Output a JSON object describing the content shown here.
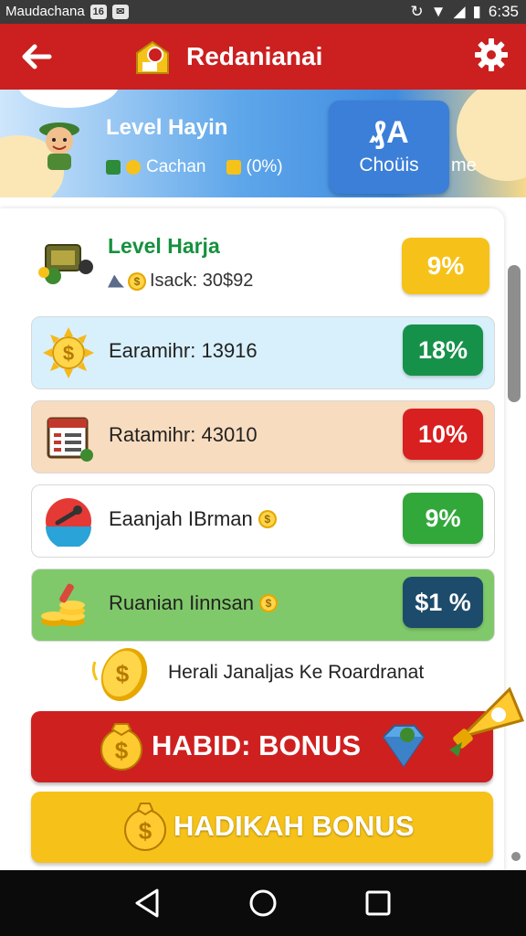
{
  "status_bar": {
    "carrier": "Maudachana",
    "time": "6:35"
  },
  "app_bar": {
    "title": "Redanianai"
  },
  "banner": {
    "level_title": "Level Hayin",
    "level_sub": "Cachan",
    "level_pct": "(0%)",
    "choose_glyph": "₰A",
    "choose_label": "Choüis",
    "trailing_text": "me"
  },
  "level_card": {
    "title": "Level Harja",
    "subtitle": "Isack: 30$92",
    "percent": "9%"
  },
  "rows": [
    {
      "label": "Earamihr: 13916",
      "percent": "18%",
      "bg": "#d8f0fb",
      "pill": "#16914a"
    },
    {
      "label": "Ratamihr: 43010",
      "percent": "10%",
      "bg": "#f8dcbf",
      "pill": "#d82020"
    },
    {
      "label": "Eaanjah IBrman",
      "percent": "9%",
      "bg": "#ffffff",
      "pill": "#32a83a"
    },
    {
      "label": "Ruanian Iinnsan",
      "percent": "$1 %",
      "bg": "#80c96a",
      "pill": "#1d4b6b"
    }
  ],
  "hint_text": "Herali Janaljas Ke Roardranat",
  "bonus_primary": "HABID: BONUS",
  "bonus_secondary": "HADIKAH BONUS",
  "colors": {
    "app_bar": "#cc1f1f",
    "level_pill": "#f6c21a",
    "bonus_primary": "#cf2020",
    "bonus_secondary": "#f6c21a",
    "accent_green": "#16913e"
  },
  "icons": [
    "back-arrow-icon",
    "app-logo-icon",
    "gear-icon",
    "avatar",
    "cannon-icon",
    "sun-coin-icon",
    "calendar-icon",
    "bowling-icon",
    "coin-stack-icon",
    "coin-icon",
    "gem-icon",
    "megaphone-icon",
    "nav-back-icon",
    "nav-home-icon",
    "nav-recents-icon"
  ]
}
